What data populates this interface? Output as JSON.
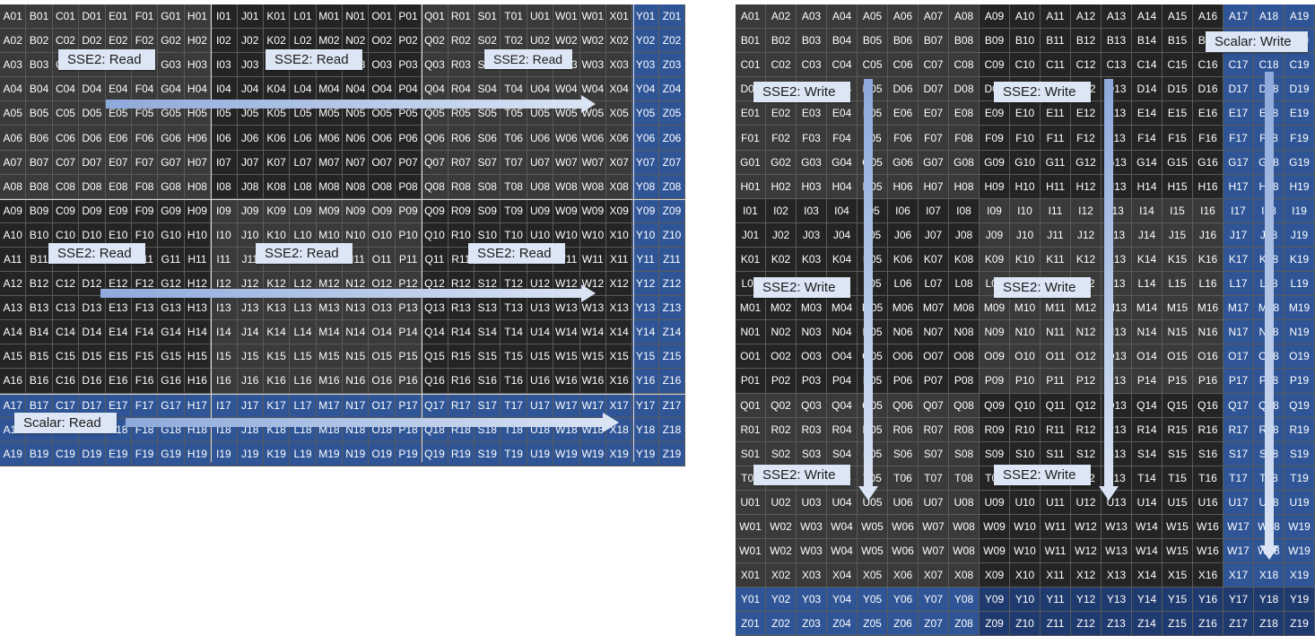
{
  "left_table": {
    "columns": [
      "A",
      "B",
      "C",
      "D",
      "E",
      "F",
      "G",
      "H",
      "I",
      "J",
      "K",
      "L",
      "M",
      "N",
      "O",
      "P",
      "Q",
      "R",
      "S",
      "T",
      "U",
      "V",
      "W",
      "X",
      "Y",
      "Z"
    ],
    "column_letter_override": {
      "21": "W"
    },
    "rows": 19,
    "blue_columns": [
      24,
      25
    ],
    "blue_rows": [
      17,
      18,
      19
    ],
    "labels": [
      {
        "id": "l1",
        "text": "SSE2: Read"
      },
      {
        "id": "l2",
        "text": "SSE2: Read"
      },
      {
        "id": "l3",
        "text": "SSE2: Read"
      },
      {
        "id": "l4",
        "text": "SSE2: Read"
      },
      {
        "id": "l5",
        "text": "SSE2: Read"
      },
      {
        "id": "l6",
        "text": "SSE2: Read"
      },
      {
        "id": "l7",
        "text": "Scalar: Read"
      }
    ]
  },
  "right_table": {
    "row_letters": [
      "A",
      "B",
      "C",
      "D",
      "E",
      "F",
      "G",
      "H",
      "I",
      "J",
      "K",
      "L",
      "M",
      "N",
      "O",
      "P",
      "Q",
      "R",
      "S",
      "T",
      "U",
      "W",
      "W",
      "X",
      "Y",
      "Z"
    ],
    "columns": 19,
    "blue_columns": [
      17,
      18,
      19
    ],
    "blue_rows": [
      "Y",
      "Z"
    ],
    "labels": [
      {
        "id": "r0",
        "text": "Scalar: Write"
      },
      {
        "id": "r1",
        "text": "SSE2: Write"
      },
      {
        "id": "r2",
        "text": "SSE2: Write"
      },
      {
        "id": "r3",
        "text": "SSE2: Write"
      },
      {
        "id": "r4",
        "text": "SSE2: Write"
      },
      {
        "id": "r5",
        "text": "SSE2: Write"
      },
      {
        "id": "r6",
        "text": "SSE2: Write"
      }
    ]
  },
  "colors": {
    "dark_cell": "#2b2b2b",
    "blue_cell": "#2f5597",
    "arrow_fill": "#c9d7ef",
    "label_bg": "#dde6f5"
  }
}
